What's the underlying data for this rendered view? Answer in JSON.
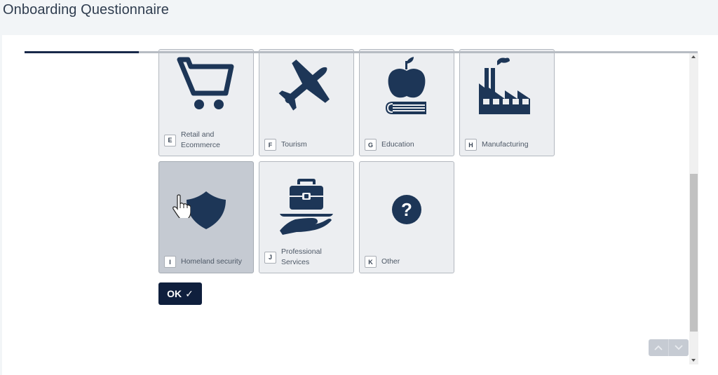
{
  "header": {
    "title": "Onboarding Questionnaire"
  },
  "progress": {
    "percent": 17
  },
  "options": [
    {
      "key": "E",
      "label": "Retail and Ecommerce",
      "icon": "shopping-cart-icon",
      "state": "default"
    },
    {
      "key": "F",
      "label": "Tourism",
      "icon": "airplane-icon",
      "state": "default"
    },
    {
      "key": "G",
      "label": "Education",
      "icon": "apple-on-book-icon",
      "state": "default"
    },
    {
      "key": "H",
      "label": "Manufacturing",
      "icon": "factory-icon",
      "state": "default"
    },
    {
      "key": "I",
      "label": "Homeland security",
      "icon": "shield-icon",
      "state": "hover"
    },
    {
      "key": "J",
      "label": "Professional Services",
      "icon": "briefcase-on-hand-icon",
      "state": "default"
    },
    {
      "key": "K",
      "label": "Other",
      "icon": "question-circle-icon",
      "state": "default"
    }
  ],
  "ok_button": {
    "label": "OK",
    "icon": "checkmark-icon"
  },
  "navigation": {
    "up_icon": "chevron-up-icon",
    "down_icon": "chevron-down-icon"
  },
  "colors": {
    "accent": "#0f1f3d",
    "icon": "#1d3657",
    "card_bg": "#eceef1",
    "card_hover_bg": "#c5cad2"
  }
}
